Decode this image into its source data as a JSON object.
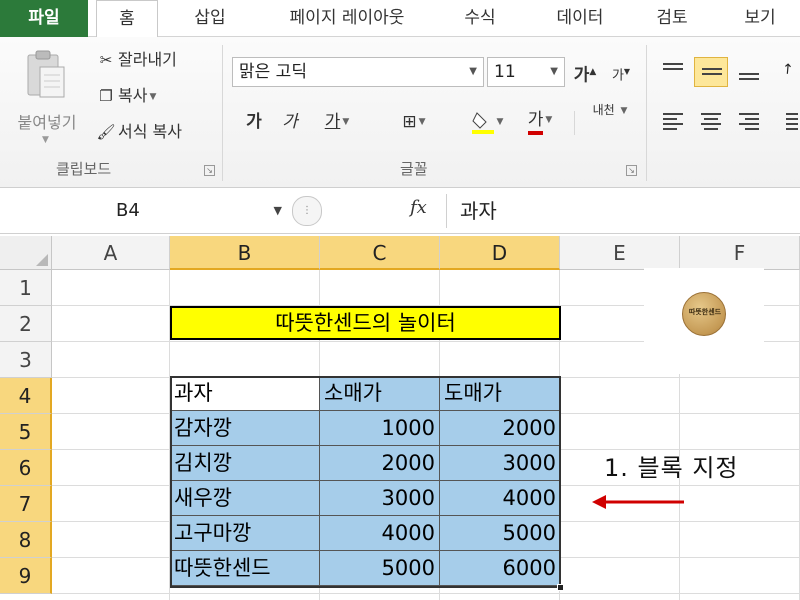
{
  "tabs": {
    "file": "파일",
    "home": "홈",
    "insert": "삽입",
    "page_layout": "페이지 레이아웃",
    "formulas": "수식",
    "data": "데이터",
    "review": "검토",
    "view": "보기"
  },
  "clipboard": {
    "paste": "붙여넣기",
    "cut": "잘라내기",
    "copy": "복사",
    "format_painter": "서식 복사",
    "group_label": "클립보드"
  },
  "font": {
    "name": "맑은 고딕",
    "size": "11",
    "grow": "가",
    "shrink": "가",
    "bold": "가",
    "italic": "가",
    "underline": "가",
    "font_color": "가",
    "phonetic": "내천",
    "group_label": "글꼴",
    "fill_color_hex": "#ffff00",
    "font_color_hex": "#d00000"
  },
  "formula_bar": {
    "name_box": "B4",
    "fx": "fx",
    "value": "과자"
  },
  "grid": {
    "columns": [
      "A",
      "B",
      "C",
      "D",
      "E",
      "F"
    ],
    "rows": [
      "1",
      "2",
      "3",
      "4",
      "5",
      "6",
      "7",
      "8",
      "9"
    ],
    "title": "따뜻한센드의 놀이터",
    "headers": [
      "과자",
      "소매가",
      "도매가"
    ],
    "data": [
      [
        "감자깡",
        "1000",
        "2000"
      ],
      [
        "김치깡",
        "2000",
        "3000"
      ],
      [
        "새우깡",
        "3000",
        "4000"
      ],
      [
        "고구마깡",
        "4000",
        "5000"
      ],
      [
        "따뜻한센드",
        "5000",
        "6000"
      ]
    ],
    "selection_color_hex": "#a6cdea"
  },
  "stamp_text": "따뜻한센드",
  "annotation": "1. 블록 지정",
  "annotation_arrow_color": "#d00000"
}
